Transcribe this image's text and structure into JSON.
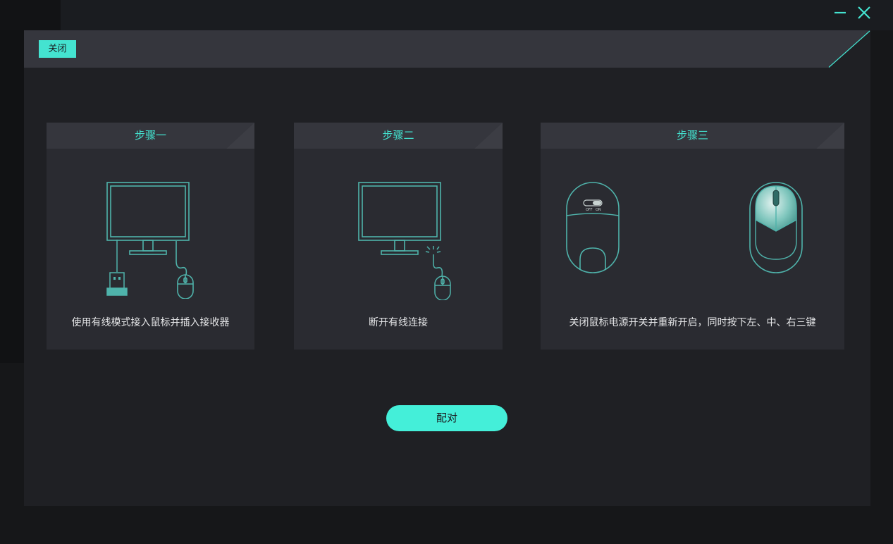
{
  "colors": {
    "accent": "#44e3d0",
    "button": "#44efd9",
    "dialog_bg": "#1f2024",
    "card_bg": "#2a2b31",
    "header_bg": "#35363d",
    "illustration": "#4fb3ab"
  },
  "window": {
    "minimize_icon": "minimize-icon",
    "close_icon": "close-icon"
  },
  "dialog": {
    "close_label": "关闭",
    "pair_label": "配对"
  },
  "steps": [
    {
      "title": "步骤一",
      "description": "使用有线模式接入鼠标并插入接收器",
      "icons": [
        "monitor-icon",
        "usb-receiver-icon",
        "wired-mouse-icon"
      ]
    },
    {
      "title": "步骤二",
      "description": "断开有线连接",
      "icons": [
        "monitor-icon",
        "disconnected-mouse-icon"
      ]
    },
    {
      "title": "步骤三",
      "description": "关闭鼠标电源开关并重新开启，同时按下左、中、右三键",
      "icons": [
        "mouse-bottom-icon",
        "mouse-top-icon"
      ],
      "switch_labels": [
        "OFF",
        "ON"
      ]
    }
  ]
}
